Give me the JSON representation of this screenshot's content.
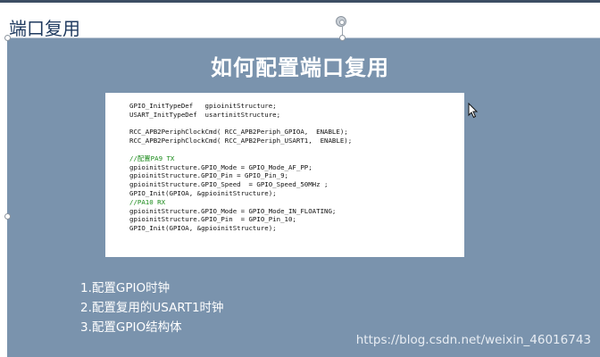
{
  "heading": "端口复用",
  "slide_title": "如何配置端口复用",
  "code_lines": [
    {
      "text": "GPIO_InitTypeDef   gpioinitStructure;",
      "kind": "code"
    },
    {
      "text": "USART_InitTypeDef  usartinitStructure;",
      "kind": "code"
    },
    {
      "text": "",
      "kind": "blank"
    },
    {
      "text": "RCC_APB2PeriphClockCmd( RCC_APB2Periph_GPIOA,  ENABLE);",
      "kind": "code"
    },
    {
      "text": "RCC_APB2PeriphClockCmd( RCC_APB2Periph_USART1,  ENABLE);",
      "kind": "code"
    },
    {
      "text": "",
      "kind": "blank"
    },
    {
      "text": "//配置PA9 TX",
      "kind": "comment"
    },
    {
      "text": "gpioinitStructure.GPIO_Mode = GPIO_Mode_AF_PP;",
      "kind": "code"
    },
    {
      "text": "gpioinitStructure.GPIO_Pin = GPIO_Pin_9;",
      "kind": "code"
    },
    {
      "text": "gpioinitStructure.GPIO_Speed  = GPIO_Speed_50MHz ;",
      "kind": "code"
    },
    {
      "text": "GPIO_Init(GPIOA, &gpioinitStructure);",
      "kind": "code"
    },
    {
      "text": "//PA10 RX",
      "kind": "comment"
    },
    {
      "text": "gpioinitStructure.GPIO_Mode = GPIO_Mode_IN_FLOATING;",
      "kind": "code"
    },
    {
      "text": "gpioinitStructure.GPIO_Pin  = GPIO_Pin_10;",
      "kind": "code"
    },
    {
      "text": "GPIO_Init(GPIOA, &gpioinitStructure);",
      "kind": "code"
    }
  ],
  "bullets": [
    "1.配置GPIO时钟",
    "2.配置复用的USART1时钟",
    "3.配置GPIO结构体"
  ],
  "watermark": "https://blog.csdn.net/weixin_46016743",
  "colors": {
    "slide_bg": "#7a93ad",
    "comment": "#1a8a1a",
    "heading": "#1f3a5f"
  }
}
